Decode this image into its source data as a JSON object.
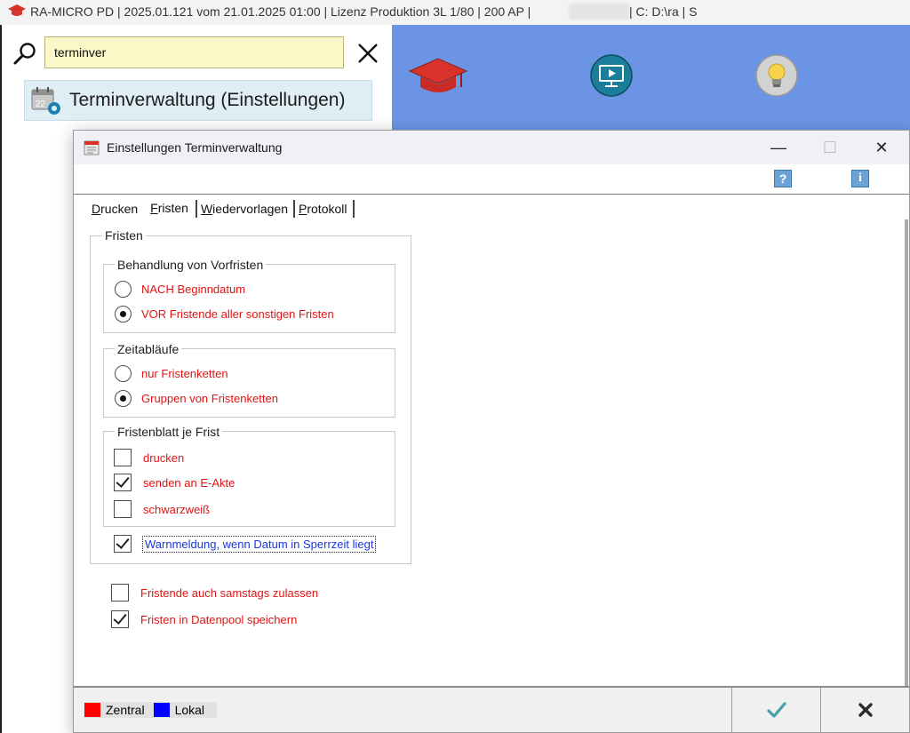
{
  "app_title": {
    "left": "RA-MICRO PD | 2025.01.121 vom 21.01.2025 01:00  | Lizenz Produktion 3L  1/80 | 200 AP |",
    "right": "| C: D:\\ra | S"
  },
  "search": {
    "value": "terminver",
    "result_label": "Terminverwaltung (Einstellungen)"
  },
  "dialog": {
    "title": "Einstellungen Terminverwaltung",
    "min_glyph": "—",
    "max_glyph": "☐",
    "close_glyph": "✕",
    "help_glyph": "?",
    "info_glyph": "i",
    "tabs": [
      {
        "first": "D",
        "rest": "rucken"
      },
      {
        "first": "F",
        "rest": "risten"
      },
      {
        "first": "W",
        "rest": "iedervorlagen"
      },
      {
        "first": "P",
        "rest": "rotokoll"
      }
    ],
    "fristen_group": "Fristen",
    "vorfristen": {
      "title": "Behandlung von Vorfristen",
      "options": [
        "NACH Beginndatum",
        "VOR Fristende aller sonstigen Fristen"
      ],
      "selected_index": 1
    },
    "zeitablaeufe": {
      "title": "Zeitabläufe",
      "options": [
        "nur Fristenketten",
        "Gruppen von Fristenketten"
      ],
      "selected_index": 1
    },
    "fristenblatt": {
      "title": "Fristenblatt je Frist",
      "items": [
        {
          "label": "drucken",
          "checked": false
        },
        {
          "label": "senden an E-Akte",
          "checked": true
        },
        {
          "label": "schwarzweiß",
          "checked": false
        }
      ]
    },
    "warnmeldung": {
      "label": "Warnmeldung, wenn Datum in Sperrzeit liegt",
      "checked": true
    },
    "samstags": {
      "label": "Fristende auch samstags zulassen",
      "checked": false
    },
    "datenpool": {
      "label": "Fristen in Datenpool speichern",
      "checked": true
    },
    "legend": [
      {
        "label": "Zentral",
        "color": "#ff0000"
      },
      {
        "label": "Lokal",
        "color": "#0000ff"
      }
    ],
    "ok_glyph": "✔",
    "cancel_glyph": "✖"
  }
}
